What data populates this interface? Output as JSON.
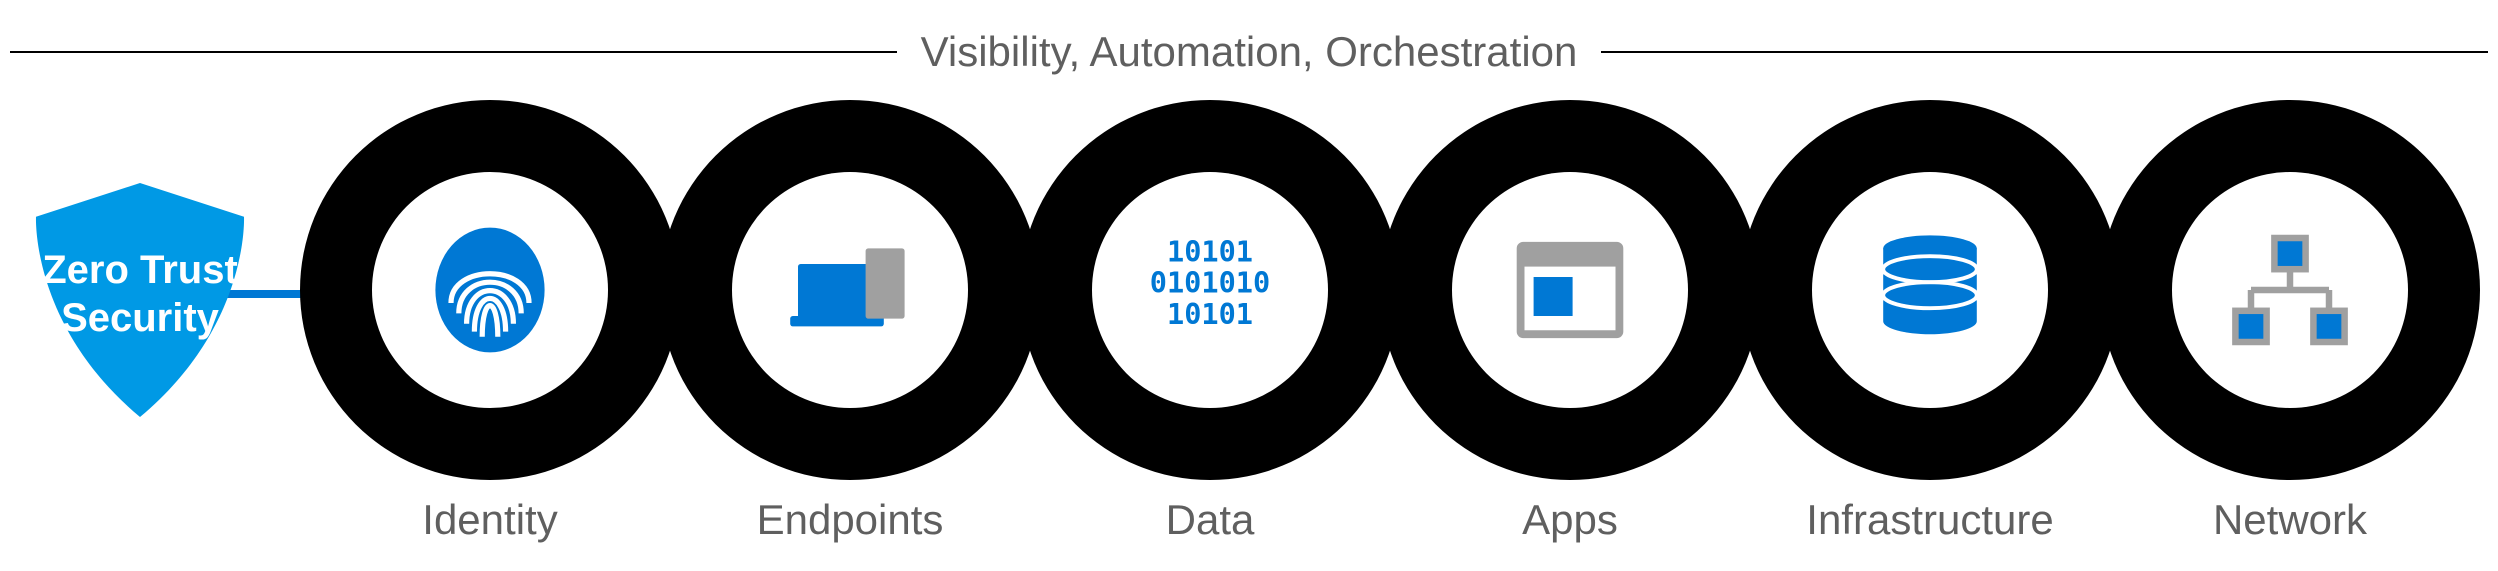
{
  "colors": {
    "accent": "#0078D4",
    "ring": "#000000",
    "gray": "#A0A0A0",
    "label": "#5f5f5f"
  },
  "top_label": "Visibility, Automation, Orchestration",
  "shield": {
    "line1": "Zero Trust",
    "line2": "Security"
  },
  "pillars": [
    {
      "label": "Identity",
      "icon": "fingerprint-icon"
    },
    {
      "label": "Endpoints",
      "icon": "devices-icon"
    },
    {
      "label": "Data",
      "icon": "binary-icon"
    },
    {
      "label": "Apps",
      "icon": "window-icon"
    },
    {
      "label": "Infrastructure",
      "icon": "database-icon"
    },
    {
      "label": "Network",
      "icon": "network-tree-icon"
    }
  ]
}
